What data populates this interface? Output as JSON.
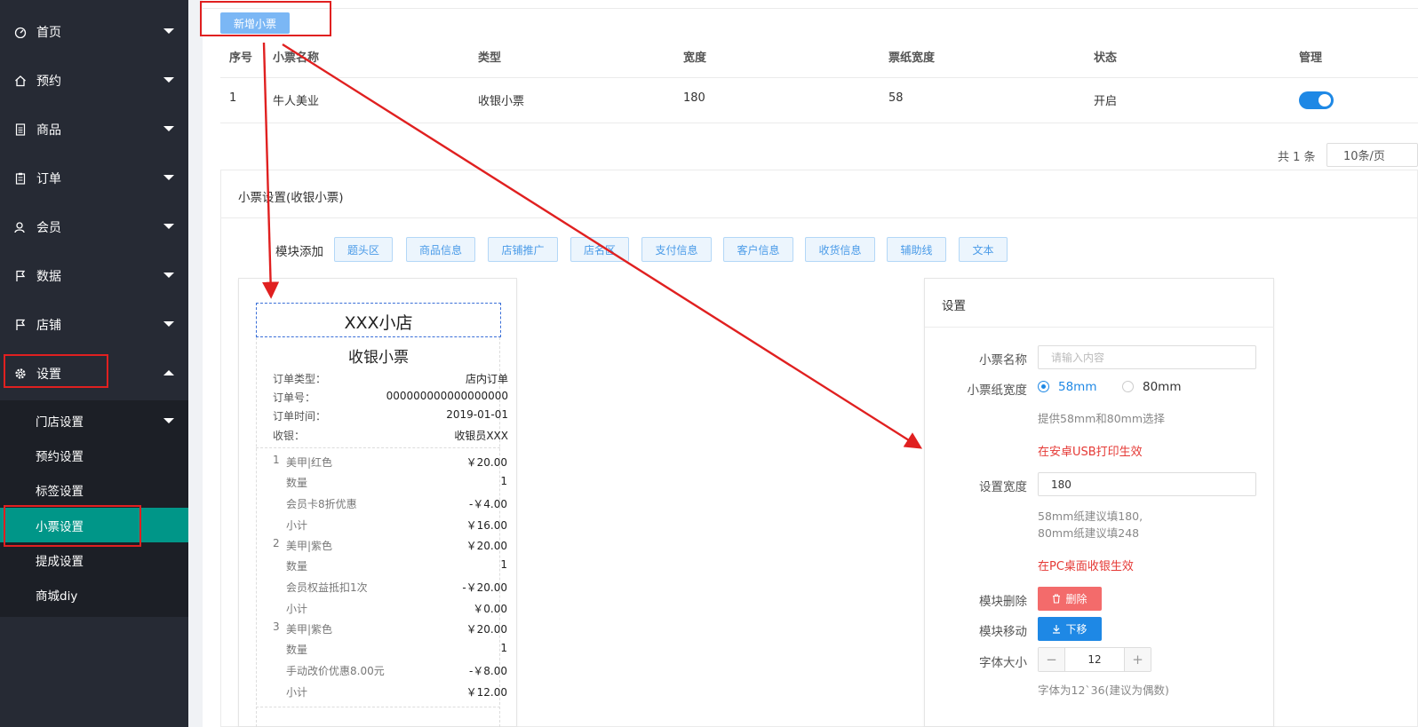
{
  "sidebar": {
    "items": [
      {
        "label": "首页",
        "icon": "dashboard-icon"
      },
      {
        "label": "预约",
        "icon": "home-icon"
      },
      {
        "label": "商品",
        "icon": "document-icon"
      },
      {
        "label": "订单",
        "icon": "clipboard-icon"
      },
      {
        "label": "会员",
        "icon": "user-icon"
      },
      {
        "label": "数据",
        "icon": "flag-icon"
      },
      {
        "label": "店铺",
        "icon": "flag-icon"
      },
      {
        "label": "设置",
        "icon": "gear-icon"
      }
    ],
    "subitems": [
      {
        "label": "门店设置"
      },
      {
        "label": "预约设置"
      },
      {
        "label": "标签设置"
      },
      {
        "label": "小票设置"
      },
      {
        "label": "提成设置"
      },
      {
        "label": "商城diy"
      }
    ]
  },
  "toolbar": {
    "add_label": "新增小票"
  },
  "table": {
    "headers": [
      "序号",
      "小票名称",
      "类型",
      "宽度",
      "票纸宽度",
      "状态",
      "管理"
    ],
    "rows": [
      {
        "index": "1",
        "name": "牛人美业",
        "type": "收银小票",
        "width": "180",
        "paper_width": "58",
        "status": "开启",
        "enabled": true
      }
    ]
  },
  "pagination": {
    "total": "共 1 条",
    "page_size": "10条/页"
  },
  "panel": {
    "title": "小票设置(收银小票)",
    "module_label": "模块添加",
    "modules": [
      "题头区",
      "商品信息",
      "店铺推广",
      "店名区",
      "支付信息",
      "客户信息",
      "收货信息",
      "辅助线",
      "文本"
    ]
  },
  "receipt": {
    "shop_name": "XXX小店",
    "title": "收银小票",
    "info": [
      {
        "label": "订单类型：",
        "value": "店内订单"
      },
      {
        "label": "订单号：",
        "value": "000000000000000000"
      },
      {
        "label": "订单时间：",
        "value": "2019-01-01"
      },
      {
        "label": "收银：",
        "value": "收银员XXX"
      }
    ],
    "items": [
      {
        "no": "1",
        "lines": [
          [
            "美甲|红色",
            "￥20.00"
          ],
          [
            "数量",
            "1"
          ],
          [
            "会员卡8折优惠",
            "-￥4.00"
          ],
          [
            "小计",
            "￥16.00"
          ]
        ]
      },
      {
        "no": "2",
        "lines": [
          [
            "美甲|紫色",
            "￥20.00"
          ],
          [
            "数量",
            "1"
          ],
          [
            "会员权益抵扣1次",
            "-￥20.00"
          ],
          [
            "小计",
            "￥0.00"
          ]
        ]
      },
      {
        "no": "3",
        "lines": [
          [
            "美甲|紫色",
            "￥20.00"
          ],
          [
            "数量",
            "1"
          ],
          [
            "手动改价优惠8.00元",
            "-￥8.00"
          ],
          [
            "小计",
            "￥12.00"
          ]
        ]
      }
    ]
  },
  "settings": {
    "title": "设置",
    "name_label": "小票名称",
    "name_placeholder": "请输入内容",
    "paper_label": "小票纸宽度",
    "paper_options": [
      "58mm",
      "80mm"
    ],
    "paper_selected": "58mm",
    "paper_hint": "提供58mm和80mm选择",
    "usb_note": "在安卓USB打印生效",
    "width_label": "设置宽度",
    "width_value": "180",
    "width_hint1": "58mm纸建议填180,",
    "width_hint2": "80mm纸建议填248",
    "pc_note": "在PC桌面收银生效",
    "delete_label": "模块删除",
    "delete_button": "删除",
    "move_label": "模块移动",
    "move_button": "下移",
    "font_label": "字体大小",
    "font_value": "12",
    "font_hint": "字体为12`36(建议为偶数)"
  },
  "colors": {
    "accent": "#1e88e5",
    "active": "#009688",
    "danger": "#f36b6b",
    "annotation": "#e02020",
    "sidebar": "#262a34"
  }
}
